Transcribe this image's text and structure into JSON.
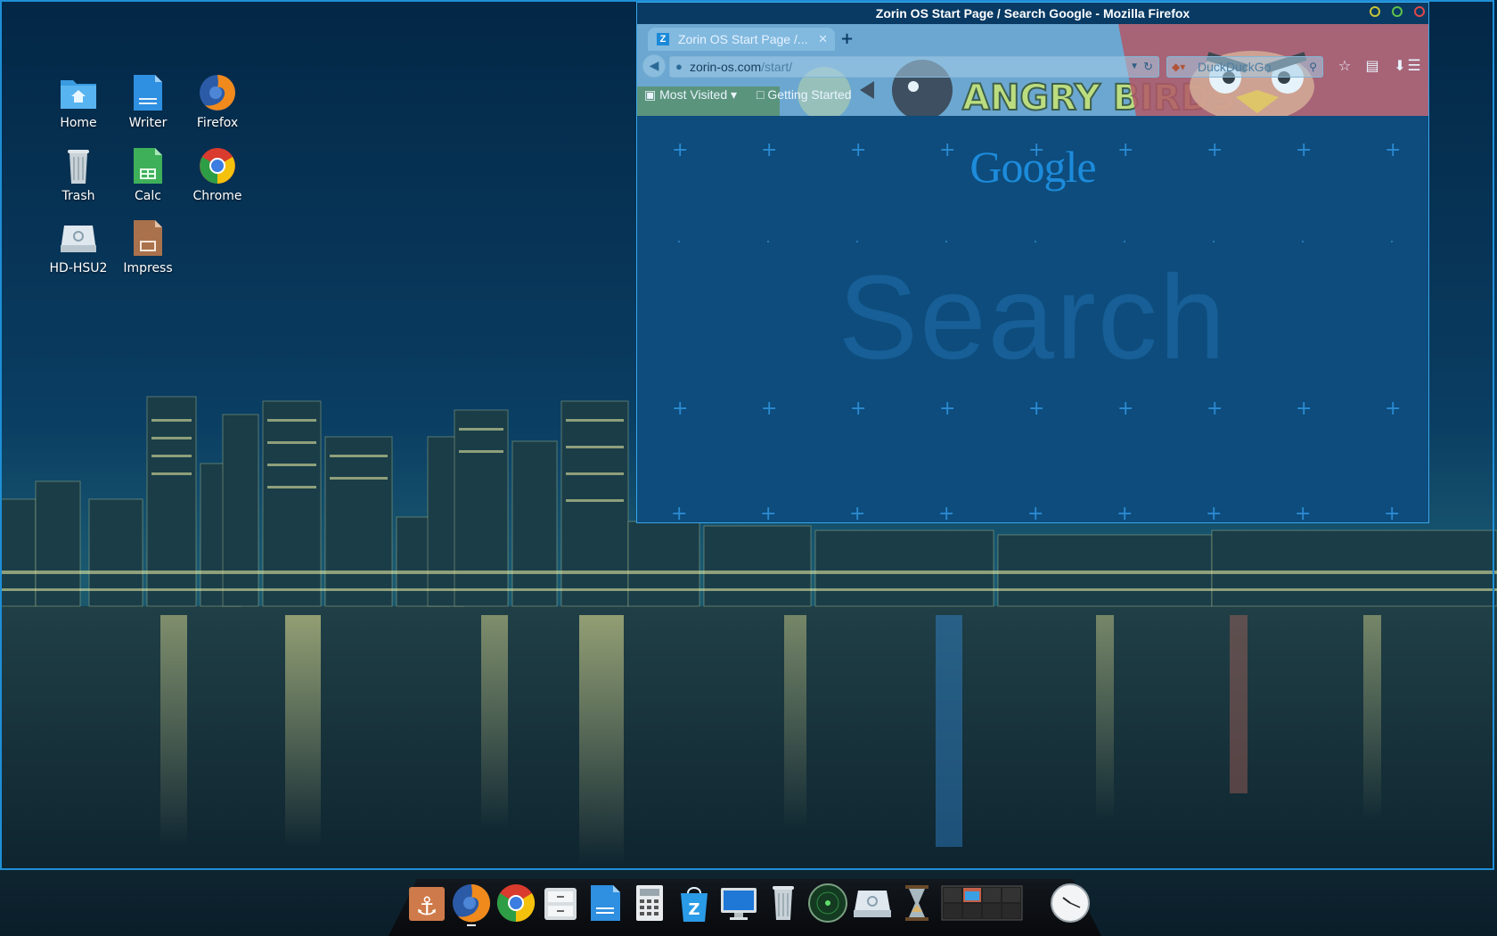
{
  "desktop": {
    "icons": [
      {
        "label": "Home",
        "icon": "home-folder-icon"
      },
      {
        "label": "Writer",
        "icon": "writer-icon"
      },
      {
        "label": "Firefox",
        "icon": "firefox-icon"
      },
      {
        "label": "Trash",
        "icon": "trash-icon"
      },
      {
        "label": "Calc",
        "icon": "calc-icon"
      },
      {
        "label": "Chrome",
        "icon": "chrome-icon"
      },
      {
        "label": "HD-HSU2",
        "icon": "drive-icon"
      },
      {
        "label": "Impress",
        "icon": "impress-icon"
      }
    ]
  },
  "window": {
    "title": "Zorin OS Start Page / Search Google - Mozilla Firefox",
    "controls": {
      "minimize": "minimize-icon",
      "maximize": "maximize-icon",
      "close": "close-icon"
    }
  },
  "firefox": {
    "tab": {
      "label": "Zorin OS Start Page /...",
      "close": "✕",
      "favicon": "Z"
    },
    "new_tab": "+",
    "url": {
      "domain": "zorin-os.com",
      "path": "/start/"
    },
    "search": {
      "engine": "DuckDuckGo",
      "placeholder": "DuckDuckGo"
    },
    "bookmarks": {
      "most_visited": "Most Visited",
      "getting_started": "Getting Started"
    },
    "persona_text": "ANGRY BIRDS"
  },
  "page": {
    "logo": "Google",
    "search_text": "Search"
  },
  "dock": {
    "items": [
      "anchor-icon",
      "firefox-icon",
      "chrome-icon",
      "file-manager-icon",
      "writer-icon",
      "calculator-icon",
      "software-store-icon",
      "monitor-icon",
      "trash-icon",
      "radar-icon",
      "drive-icon",
      "hourglass-icon",
      "workspace-switcher-icon",
      "clock-icon"
    ]
  },
  "colors": {
    "accent": "#1e8fd6",
    "window_title_bg": "#083a63",
    "content_bg": "#0d4c7c"
  }
}
